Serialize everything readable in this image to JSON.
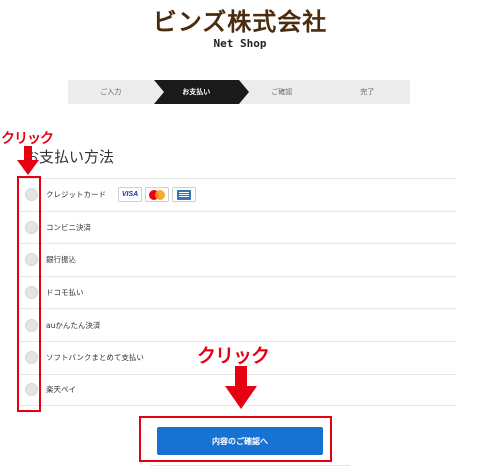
{
  "header": {
    "logo_main": "ビンズ株式会社",
    "logo_sub": "Net Shop"
  },
  "steps": [
    {
      "label": "ご入力",
      "active": false
    },
    {
      "label": "お支払い",
      "active": true
    },
    {
      "label": "ご確認",
      "active": false
    },
    {
      "label": "完了",
      "active": false
    }
  ],
  "payment": {
    "title": "お支払い方法",
    "methods": [
      {
        "label": "クレジットカード",
        "cards": [
          "visa-icon",
          "mastercard-icon",
          "amex-icon"
        ]
      },
      {
        "label": "コンビニ決済"
      },
      {
        "label": "銀行振込"
      },
      {
        "label": "ドコモ払い"
      },
      {
        "label": "auかんたん決済"
      },
      {
        "label": "ソフトバンクまとめて支払い"
      },
      {
        "label": "楽天ペイ"
      }
    ],
    "card_visa_text": "VISA"
  },
  "confirm_button": "内容のご確認へ",
  "annotations": {
    "left_label": "クリック",
    "right_label": "クリック",
    "color": "#e60012"
  },
  "colors": {
    "accent": "#1673d4",
    "brand": "#4a2c10",
    "active_step": "#1a1a1a"
  }
}
